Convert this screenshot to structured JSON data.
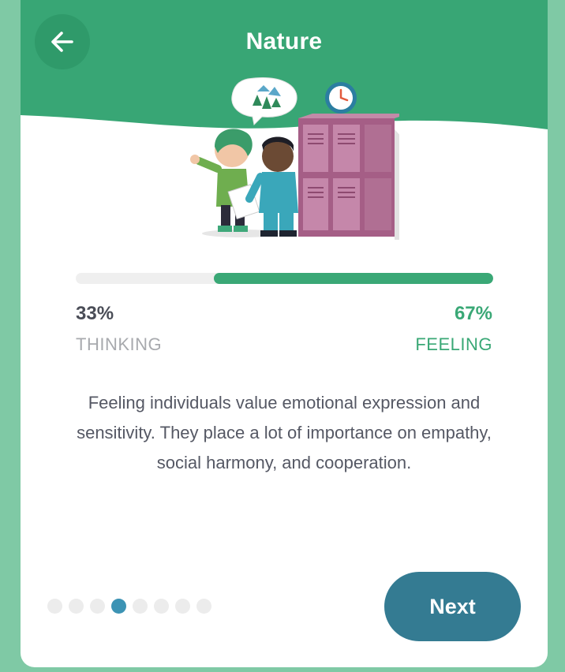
{
  "header": {
    "title": "Nature",
    "back_icon": "arrow-left-icon",
    "color": "#38a675"
  },
  "trait": {
    "left_percent": "33%",
    "left_label": "THINKING",
    "right_percent": "67%",
    "right_label": "FEELING",
    "feeling_fraction": 0.67
  },
  "description": "Feeling individuals value emotional expression and sensitivity. They place a lot of importance on empathy, social harmony, and cooperation.",
  "pagination": {
    "count": 8,
    "active_index": 3
  },
  "actions": {
    "next_label": "Next"
  },
  "colors": {
    "background": "#7fc9a5",
    "accent_green": "#3aa876",
    "next_button": "#347b92",
    "active_dot": "#3c93b4"
  }
}
